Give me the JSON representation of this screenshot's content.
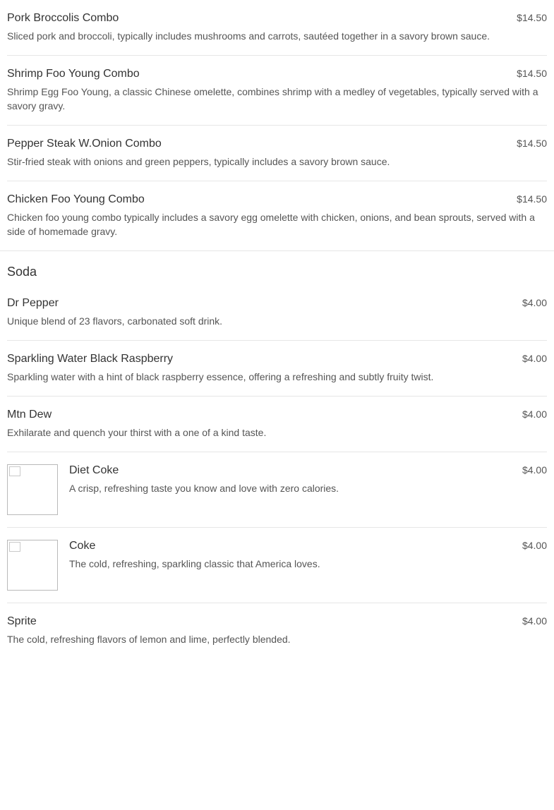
{
  "combos": [
    {
      "name": "Pork Broccolis Combo",
      "price": "$14.50",
      "description": "Sliced pork and broccoli, typically includes mushrooms and carrots, sautéed together in a savory brown sauce."
    },
    {
      "name": "Shrimp Foo Young Combo",
      "price": "$14.50",
      "description": "Shrimp Egg Foo Young, a classic Chinese omelette, combines shrimp with a medley of vegetables, typically served with a savory gravy."
    },
    {
      "name": "Pepper Steak W.Onion Combo",
      "price": "$14.50",
      "description": "Stir-fried steak with onions and green peppers, typically includes a savory brown sauce."
    },
    {
      "name": "Chicken Foo Young Combo",
      "price": "$14.50",
      "description": "Chicken foo young combo typically includes a savory egg omelette with chicken, onions, and bean sprouts, served with a side of homemade gravy."
    }
  ],
  "soda": {
    "title": "Soda",
    "items": [
      {
        "name": "Dr Pepper",
        "price": "$4.00",
        "description": "Unique blend of 23 flavors, carbonated soft drink."
      },
      {
        "name": "Sparkling Water Black Raspberry",
        "price": "$4.00",
        "description": "Sparkling water with a hint of black raspberry essence, offering a refreshing and subtly fruity twist."
      },
      {
        "name": "Mtn Dew",
        "price": "$4.00",
        "description": "Exhilarate and quench your thirst with a one of a kind taste."
      },
      {
        "name": "Diet Coke",
        "price": "$4.00",
        "description": "A crisp, refreshing taste you know and love with zero calories.",
        "has_image": true
      },
      {
        "name": "Coke",
        "price": "$4.00",
        "description": "The cold, refreshing, sparkling classic that America loves.",
        "has_image": true
      },
      {
        "name": "Sprite",
        "price": "$4.00",
        "description": "The cold, refreshing flavors of lemon and lime, perfectly blended."
      }
    ]
  }
}
